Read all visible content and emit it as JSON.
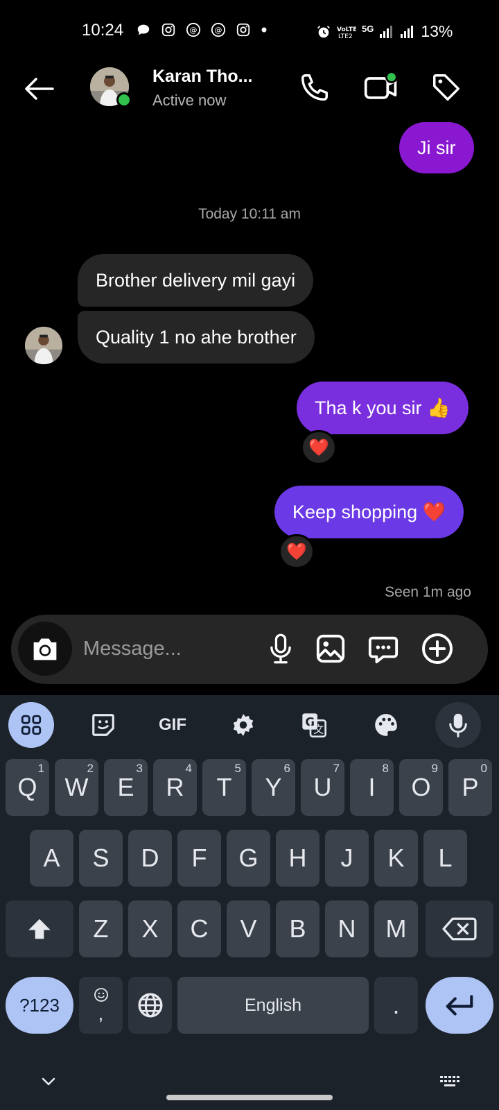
{
  "status_bar": {
    "time": "10:24",
    "battery": "13%",
    "network_label": "5G",
    "left_icons": [
      "chat-bubble-icon",
      "instagram-icon",
      "threads-icon",
      "threads-icon",
      "instagram-icon",
      "dot-icon"
    ],
    "right_icons": [
      "alarm-icon",
      "volte-icon",
      "signal-icon",
      "signal-icon"
    ]
  },
  "header": {
    "contact_name": "Karan Tho...",
    "contact_status": "Active now",
    "icons": [
      "back-arrow-icon",
      "phone-icon",
      "video-icon",
      "tag-icon"
    ]
  },
  "conversation": {
    "timestamp": "Today 10:11 am",
    "seen": "Seen 1m ago",
    "messages": [
      {
        "direction": "outgoing",
        "text": "Ji sir"
      },
      {
        "direction": "incoming",
        "text": "Brother delivery mil gayi"
      },
      {
        "direction": "incoming",
        "text": "Quality 1 no ahe brother"
      },
      {
        "direction": "outgoing",
        "text": "Tha k you sir 👍",
        "reaction": "❤️"
      },
      {
        "direction": "outgoing",
        "text": "Keep shopping ❤️",
        "reaction": "❤️"
      }
    ]
  },
  "composer": {
    "placeholder": "Message...",
    "icons": [
      "camera-icon",
      "microphone-icon",
      "image-icon",
      "chat-more-icon",
      "plus-circle-icon"
    ]
  },
  "keyboard": {
    "toolbar": {
      "gif_label": "GIF",
      "icons": [
        "apps-grid-icon",
        "sticker-icon",
        "gif-icon",
        "settings-gear-icon",
        "translate-icon",
        "palette-icon",
        "microphone-icon"
      ]
    },
    "row1": [
      {
        "key": "Q",
        "hint": "1"
      },
      {
        "key": "W",
        "hint": "2"
      },
      {
        "key": "E",
        "hint": "3"
      },
      {
        "key": "R",
        "hint": "4"
      },
      {
        "key": "T",
        "hint": "5"
      },
      {
        "key": "Y",
        "hint": "6"
      },
      {
        "key": "U",
        "hint": "7"
      },
      {
        "key": "I",
        "hint": "8"
      },
      {
        "key": "O",
        "hint": "9"
      },
      {
        "key": "P",
        "hint": "0"
      }
    ],
    "row2": [
      "A",
      "S",
      "D",
      "F",
      "G",
      "H",
      "J",
      "K",
      "L"
    ],
    "row3": [
      "Z",
      "X",
      "C",
      "V",
      "B",
      "N",
      "M"
    ],
    "symbols_label": "?123",
    "emoji_comma_label": ",",
    "space_label": "English",
    "period_label": ".",
    "accent": "#aec4f5"
  }
}
